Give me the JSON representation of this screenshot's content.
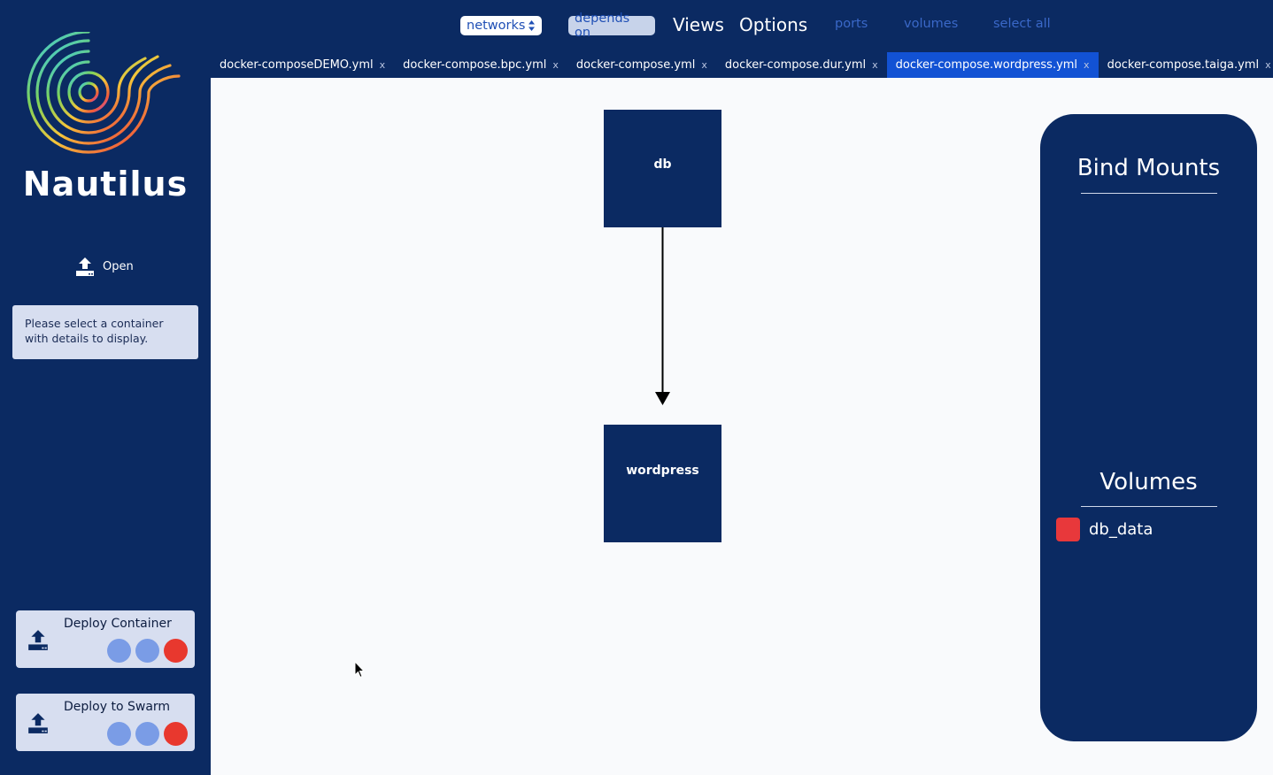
{
  "window": {
    "traffic_lights": [
      "close",
      "minimize",
      "zoom"
    ]
  },
  "sidebar": {
    "brand": "Nautilus",
    "open_label": "Open",
    "details_text": "Please select a container with details to display.",
    "deploy_container_label": "Deploy Container",
    "deploy_swarm_label": "Deploy to Swarm",
    "status_dots": [
      "#7a9ce6",
      "#7a9ce6",
      "#e8382e"
    ]
  },
  "topbar": {
    "networks_label": "networks",
    "depends_on_label": "depends on",
    "views_label": "Views",
    "options_label": "Options",
    "ports_label": "ports",
    "volumes_label": "volumes",
    "select_all_label": "select all"
  },
  "tabs": [
    {
      "label": "docker-composeDEMO.yml",
      "close": "x",
      "active": false
    },
    {
      "label": "docker-compose.bpc.yml",
      "close": "x",
      "active": false
    },
    {
      "label": "docker-compose.yml",
      "close": "x",
      "active": false
    },
    {
      "label": "docker-compose.dur.yml",
      "close": "x",
      "active": false
    },
    {
      "label": "docker-compose.wordpress.yml",
      "close": "x",
      "active": true
    },
    {
      "label": "docker-compose.taiga.yml",
      "close": "x",
      "active": false
    }
  ],
  "graph": {
    "nodes": [
      {
        "id": "db",
        "label": "db"
      },
      {
        "id": "wordpress",
        "label": "wordpress"
      }
    ],
    "edges": [
      {
        "from": "db",
        "to": "wordpress"
      }
    ]
  },
  "panel": {
    "bind_mounts_title": "Bind Mounts",
    "volumes_title": "Volumes",
    "volumes": [
      {
        "name": "db_data",
        "color": "#e8383b"
      }
    ]
  },
  "colors": {
    "navy": "#0b2a62",
    "active_tab": "#1252d4",
    "canvas": "#f9fafc",
    "panel_card": "#d7def0"
  }
}
